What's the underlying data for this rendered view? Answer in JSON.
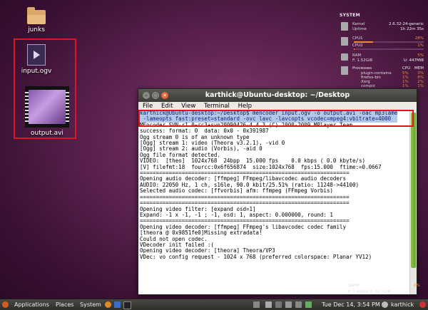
{
  "desktop": {
    "icons": [
      {
        "label": "junks",
        "kind": "folder"
      },
      {
        "label": "input.ogv",
        "kind": "video"
      },
      {
        "label": "output.avi",
        "kind": "video-film"
      }
    ]
  },
  "sysmon": {
    "title": "SYSTEM",
    "kernel_label": "Kernel",
    "kernel_value": "2.6.32-24-generic",
    "uptime_label": "Uptime",
    "uptime_value": "1h 22m 35s",
    "cpu1_label": "CPU1",
    "cpu1_value": "28%",
    "cpu2_label": "CPU2",
    "cpu2_value": "1%",
    "ram_label": "RAM",
    "ram_value": "5%",
    "free_label": "F: 1.52GiB",
    "free_value": "U: 447MiB",
    "processes_label": "Processes",
    "cpu_col": "CPU",
    "mem_col": "MEM",
    "processes": [
      {
        "name": "plugin-containe",
        "cpu": "5%",
        "mem": "3%"
      },
      {
        "name": "firefox-bin",
        "cpu": "1%",
        "mem": "8%"
      },
      {
        "name": "Xorg",
        "cpu": "1%",
        "mem": "2%"
      },
      {
        "name": "compiz",
        "cpu": "1%",
        "mem": "1%"
      }
    ],
    "swap_label": "SWAP",
    "swap_value": "0%",
    "disk_label": "F: 7.40GiB U: 31.7GiB",
    "accent": "#f08a3a"
  },
  "terminal": {
    "title": "karthick@Ubuntu-desktop: ~/Desktop",
    "menu": [
      "File",
      "Edit",
      "View",
      "Terminal",
      "Help"
    ],
    "cmd1": "karthick@Ubuntu-desktop:~/Desktop$ mencoder input.ogv -o output.avi -oac mp3lame",
    "cmd2": " -lameopts fast:preset=standard -ovc lavc -lavcopts vcodec=mpeg4:vbitrate=4000",
    "output": "MEncoder SVN-r1.0~rc3+svn20090426-4.4.3 (C) 2000-2009 MPlayer Team\nsuccess: format: 0  data: 0x0 - 0x391987\nOgg stream 0 is of an unknown type\n[Ogg] stream 1: video (Theora v3.2.1), -vid 0\n[Ogg] stream 2: audio (Vorbis), -aid 0\nOgg file format detected.\nVIDEO:  [theo]  1024x768  24bpp  15.000 fps    0.0 kbps ( 0.0 kbyte/s)\n[V] filefmt:18  fourcc:0x6f656874  size:1024x768  fps:15.000  ftime:=0.0667\n=================================================================\nOpening audio decoder: [ffmpeg] FFmpeg/libavcodec audio decoders\nAUDIO: 22050 Hz, 1 ch, s16le, 90.0 kbit/25.51% (ratio: 11248->44100)\nSelected audio codec: [ffvorbis] afm: ffmpeg (FFmpeg Vorbis)\n=================================================================\n=================================================================\nOpening video filter: [expand osd=1]\nExpand: -1 x -1, -1 ; -1, osd: 1, aspect: 0.000000, round: 1\n=================================================================\nOpening video decoder: [ffmpeg] FFmpeg's libavcodec codec family\n[theora @ 0x9851fe0]Missing extradata!\nCould not open codec.\nVDecoder init failed :(\nOpening video decoder: [theora] Theora/VP3\nVDec: vo config request - 1024 x 768 (preferred colorspace: Planar YV12)"
  },
  "panel": {
    "applications": "Applications",
    "places": "Places",
    "system": "System",
    "datetime": "Tue Dec 14,  3:54 PM",
    "user": "karthick"
  }
}
